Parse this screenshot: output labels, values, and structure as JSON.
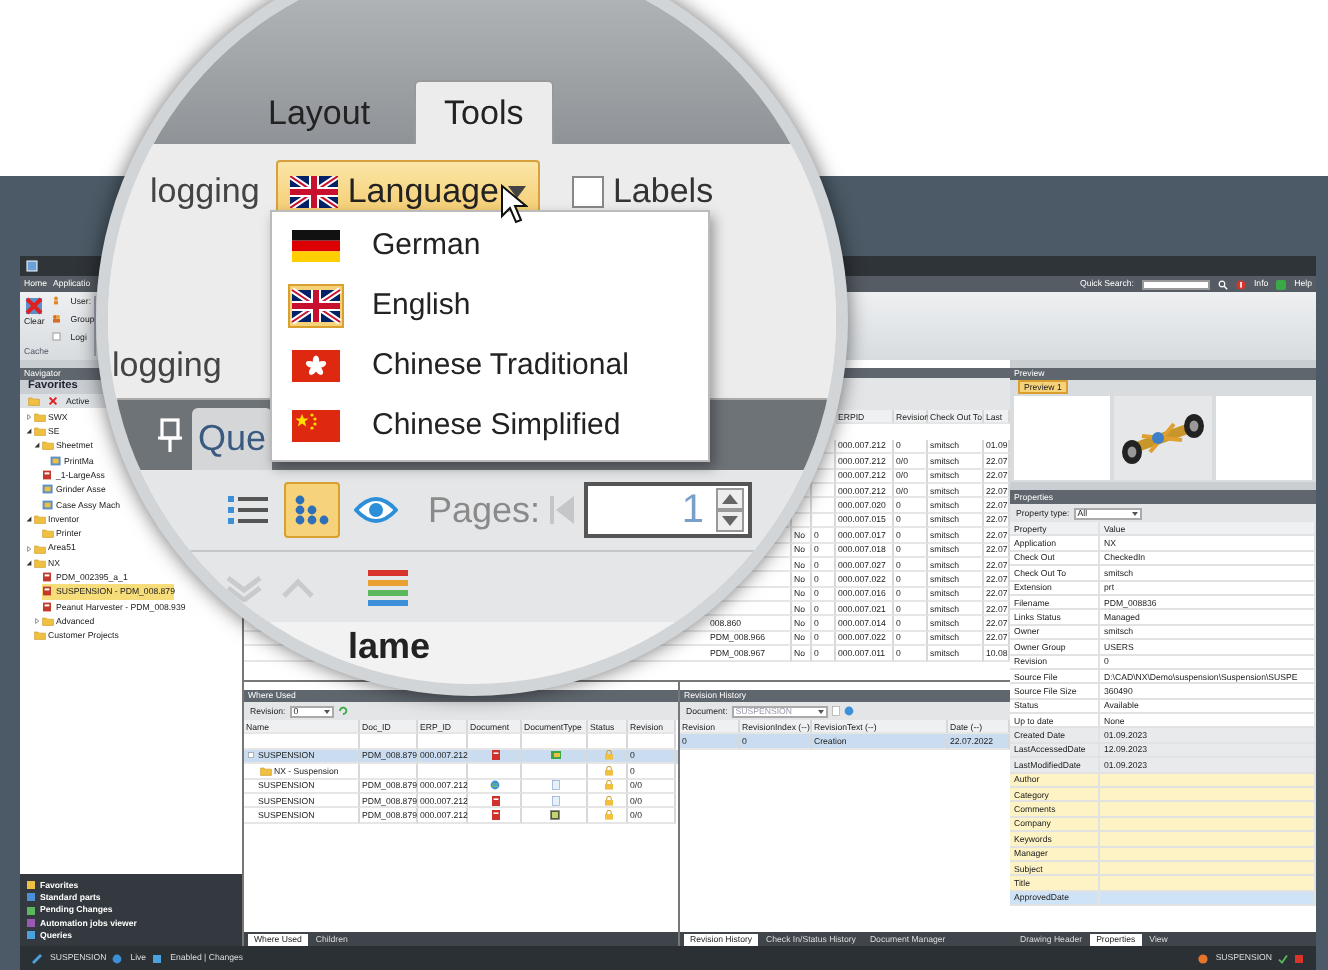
{
  "app": {
    "ribbon_tabs": [
      "Home",
      "Applicatio"
    ],
    "quick_search": {
      "label": "Quick Search:"
    },
    "help_links": [
      "Info",
      "Help"
    ],
    "cache_group": {
      "clear_button": "Clear",
      "items": [
        "User:",
        "Group",
        "Logi"
      ],
      "label": "Cache"
    },
    "navigator": {
      "title": "Navigator",
      "section": "Favorites",
      "toolbar_text": "Active",
      "tree": [
        {
          "label": "SWX",
          "kind": "folder",
          "expanded": false,
          "selected": false
        },
        {
          "label": "SE",
          "kind": "folder",
          "expanded": true,
          "selected": false,
          "children": [
            {
              "label": "Sheetmet",
              "kind": "folder",
              "expanded": true,
              "selected": false,
              "children": [
                {
                  "label": "PrintMa",
                  "kind": "assembly",
                  "selected": false
                }
              ]
            },
            {
              "label": "_1-LargeAss",
              "kind": "part",
              "selected": false
            },
            {
              "label": "Grinder Asse",
              "kind": "assembly",
              "selected": false
            },
            {
              "label": "Case Assy Mach",
              "kind": "assembly",
              "selected": false
            }
          ]
        },
        {
          "label": "Inventor",
          "kind": "folder",
          "expanded": true,
          "selected": false,
          "children": [
            {
              "label": "Printer",
              "kind": "folder",
              "selected": false
            }
          ]
        },
        {
          "label": "Area51",
          "kind": "folder",
          "expanded": false,
          "selected": false
        },
        {
          "label": "NX",
          "kind": "folder",
          "expanded": true,
          "selected": false,
          "children": [
            {
              "label": "PDM_002395_a_1",
              "kind": "part",
              "selected": false
            },
            {
              "label": "SUSPENSION - PDM_008.879",
              "kind": "part",
              "selected": true
            },
            {
              "label": "Peanut Harvester - PDM_008.939",
              "kind": "part",
              "selected": false
            },
            {
              "label": "Advanced",
              "kind": "folder",
              "expanded": false,
              "selected": false
            }
          ]
        },
        {
          "label": "Customer Projects",
          "kind": "folder",
          "selected": false
        }
      ],
      "bottom_items": [
        "Favorites",
        "Standard parts",
        "Pending Changes",
        "Automation jobs viewer",
        "Queries"
      ]
    },
    "documents_grid": {
      "columns": [
        "ERPID",
        "Revision",
        "Check Out To",
        "Last"
      ],
      "rows": [
        {
          "erpid": "000.007.212",
          "revision": "0",
          "checkout": "smitsch",
          "last": "01.09"
        },
        {
          "erpid": "000.007.212",
          "revision": "0/0",
          "checkout": "smitsch",
          "last": "22.07"
        },
        {
          "erpid": "000.007.212",
          "revision": "0/0",
          "checkout": "smitsch",
          "last": "22.07"
        },
        {
          "erpid": "000.007.212",
          "revision": "0/0",
          "checkout": "smitsch",
          "last": "22.07"
        },
        {
          "erpid": "000.007.020",
          "revision": "0",
          "checkout": "smitsch",
          "last": "22.07"
        },
        {
          "erpid": "000.007.015",
          "revision": "0",
          "checkout": "smitsch",
          "last": "22.07"
        },
        {
          "column_1": "No",
          "column_2": "0",
          "erpid": "000.007.017",
          "revision": "0",
          "checkout": "smitsch",
          "last": "22.07"
        },
        {
          "column_1": "No",
          "column_2": "0",
          "erpid": "000.007.018",
          "revision": "0",
          "checkout": "smitsch",
          "last": "22.07"
        },
        {
          "column_1": "No",
          "column_2": "0",
          "erpid": "000.007.027",
          "revision": "0",
          "checkout": "smitsch",
          "last": "22.07"
        },
        {
          "column_1": "No",
          "column_2": "0",
          "erpid": "000.007.022",
          "revision": "0",
          "checkout": "smitsch",
          "last": "22.07"
        },
        {
          "column_1": "No",
          "column_2": "0",
          "erpid": "000.007.016",
          "revision": "0",
          "checkout": "smitsch",
          "last": "22.07"
        },
        {
          "column_1": "No",
          "column_2": "0",
          "erpid": "000.007.021",
          "revision": "0",
          "checkout": "smitsch",
          "last": "22.07"
        },
        {
          "name": "008.860",
          "column_1": "No",
          "column_2": "0",
          "erpid": "000.007.014",
          "revision": "0",
          "checkout": "smitsch",
          "last": "22.07"
        },
        {
          "name": "PDM_008.966",
          "column_1": "No",
          "column_2": "0",
          "erpid": "000.007.022",
          "revision": "0",
          "checkout": "smitsch",
          "last": "22.07"
        },
        {
          "name": "PDM_008.967",
          "column_1": "No",
          "column_2": "0",
          "erpid": "000.007.011",
          "revision": "0",
          "checkout": "smitsch",
          "last": "10.08"
        }
      ]
    },
    "where_used": {
      "title": "Where Used",
      "revision_label": "Revision:",
      "revision_value": "0",
      "columns": [
        "Name",
        "Doc_ID",
        "ERP_ID",
        "Document",
        "DocumentType",
        "Status",
        "Revision"
      ],
      "rows": [
        {
          "kind": "assembly",
          "name": "SUSPENSION",
          "doc_id": "PDM_008.879",
          "erp_id": "000.007.212",
          "revision": "0",
          "selected": true
        },
        {
          "kind": "group",
          "name": "NX - Suspension",
          "revision": "0",
          "selected": false
        },
        {
          "kind": "model",
          "name": "SUSPENSION",
          "doc_id": "PDM_008.879",
          "erp_id": "000.007.212",
          "revision": "0/0",
          "selected": false
        },
        {
          "kind": "document",
          "name": "SUSPENSION",
          "doc_id": "PDM_008.879",
          "erp_id": "000.007.212",
          "revision": "0/0",
          "selected": false
        },
        {
          "kind": "drawing",
          "name": "SUSPENSION",
          "doc_id": "PDM_008.879",
          "erp_id": "000.007.212",
          "revision": "0/0",
          "selected": false
        }
      ],
      "tabs": [
        {
          "label": "Where Used",
          "selected": true
        },
        {
          "label": "Children",
          "selected": false
        }
      ]
    },
    "revision_history": {
      "title": "Revision History",
      "document_label": "Document:",
      "document_value": "SUSPENSION",
      "columns": [
        "Revision",
        "RevisionIndex (--)",
        "RevisionText (--)",
        "Date (--)"
      ],
      "rows": [
        {
          "cells": [
            "0",
            "0",
            "Creation",
            "22.07.2022"
          ],
          "selected": true
        }
      ],
      "tabs": [
        {
          "label": "Revision History",
          "selected": true
        },
        {
          "label": "Check In/Status History",
          "selected": false
        },
        {
          "label": "Document Manager",
          "selected": false
        }
      ]
    },
    "preview": {
      "title": "Preview",
      "tabs": [
        {
          "label": "Preview 1",
          "selected": true
        }
      ]
    },
    "properties": {
      "title": "Properties",
      "type_label": "Property type:",
      "type_value": "All",
      "columns": [
        "Property",
        "Value"
      ],
      "rows": [
        {
          "kind": "info",
          "name": "Application",
          "value": "NX"
        },
        {
          "kind": "info",
          "name": "Check Out",
          "value": "CheckedIn"
        },
        {
          "kind": "info",
          "name": "Check Out To",
          "value": "smitsch"
        },
        {
          "kind": "info",
          "name": "Extension",
          "value": "prt"
        },
        {
          "kind": "info",
          "name": "Filename",
          "value": "PDM_008836"
        },
        {
          "kind": "info",
          "name": "Links Status",
          "value": "Managed"
        },
        {
          "kind": "info",
          "name": "Owner",
          "value": "smitsch"
        },
        {
          "kind": "info",
          "name": "Owner Group",
          "value": "USERS"
        },
        {
          "kind": "info",
          "name": "Revision",
          "value": "0"
        },
        {
          "kind": "info",
          "name": "Source File",
          "value": "D:\\CAD\\NX\\Demo\\suspension\\Suspension\\SUSPE"
        },
        {
          "kind": "info",
          "name": "Source File Size",
          "value": "360490"
        },
        {
          "kind": "info",
          "name": "Status",
          "value": "Available"
        },
        {
          "kind": "info",
          "name": "Up to date",
          "value": "None"
        },
        {
          "kind": "date",
          "name": "Created Date",
          "value": "01.09.2023"
        },
        {
          "kind": "date",
          "name": "LastAccessedDate",
          "value": "12.09.2023"
        },
        {
          "kind": "date",
          "name": "LastModifiedDate",
          "value": "01.09.2023"
        },
        {
          "kind": "summary",
          "name": "Author"
        },
        {
          "kind": "summary",
          "name": "Category"
        },
        {
          "kind": "summary",
          "name": "Comments"
        },
        {
          "kind": "summary",
          "name": "Company"
        },
        {
          "kind": "summary",
          "name": "Keywords"
        },
        {
          "kind": "summary",
          "name": "Manager"
        },
        {
          "kind": "summary",
          "name": "Subject"
        },
        {
          "kind": "summary",
          "name": "Title"
        },
        {
          "kind": "approval",
          "name": "ApprovedDate"
        }
      ],
      "tabs": [
        {
          "label": "Drawing Header",
          "selected": false
        },
        {
          "label": "Properties",
          "selected": true
        },
        {
          "label": "View",
          "selected": false
        }
      ]
    },
    "status_bar": {
      "items": [
        "SUSPENSION",
        "Live",
        "Enabled | Changes"
      ],
      "right_text": "SUSPENSION"
    }
  },
  "lens": {
    "tabs": [
      {
        "label": "Layout",
        "selected": false
      },
      {
        "label": "Tools",
        "selected": true
      }
    ],
    "ribbon_text": "logging",
    "language_button": {
      "label": "Language",
      "kind": "gb"
    },
    "labels_checkbox": {
      "label": "Labels",
      "checked": false
    },
    "group_label": "logging",
    "panel_tab": "Que",
    "view_buttons": [
      {
        "kind": "list",
        "selected": false
      },
      {
        "kind": "dots",
        "selected": true
      },
      {
        "kind": "eye",
        "selected": false
      }
    ],
    "pages_label": "Pages:",
    "page_value": "1",
    "column_header": "lame",
    "language_menu": [
      {
        "label": "German",
        "kind": "de",
        "selected": false
      },
      {
        "label": "English",
        "kind": "gb",
        "selected": true
      },
      {
        "label": "Chinese Traditional",
        "kind": "hk",
        "selected": false
      },
      {
        "label": "Chinese Simplified",
        "kind": "cn",
        "selected": false
      }
    ]
  }
}
